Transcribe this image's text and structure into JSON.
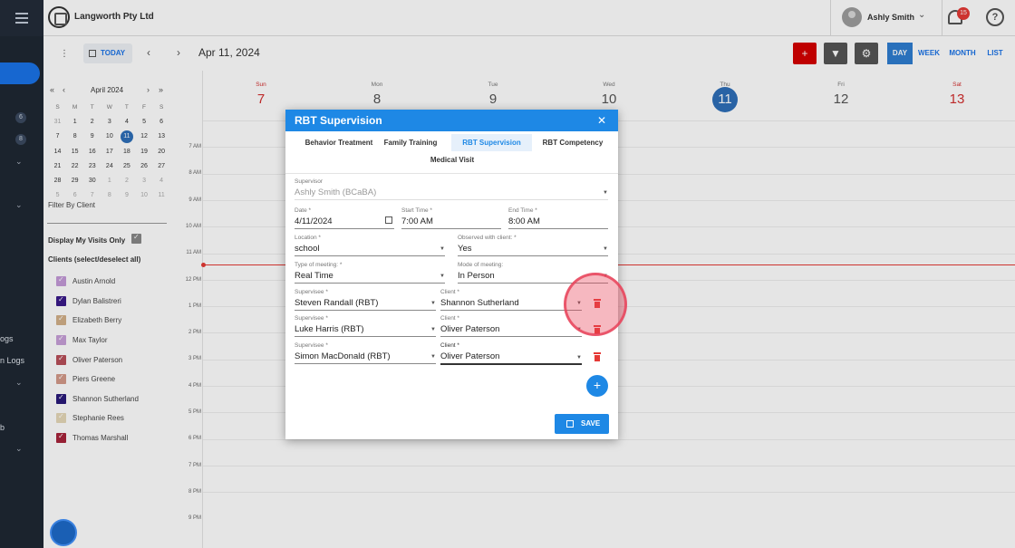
{
  "app": {
    "company": "Langworth Pty Ltd",
    "user_name": "Ashly Smith",
    "notification_count": "15",
    "help_glyph": "?"
  },
  "leftnav": {
    "badges": [
      "6",
      "8"
    ],
    "cut_labels": [
      "ogs",
      "n Logs",
      "b"
    ]
  },
  "toolbar": {
    "today_label": "TODAY",
    "current_date": "Apr 11, 2024",
    "add_glyph": "+",
    "views": [
      "DAY",
      "WEEK",
      "MONTH",
      "LIST"
    ],
    "active_view": "DAY"
  },
  "minical": {
    "title": "April 2024",
    "weekday_headers": [
      "S",
      "M",
      "T",
      "W",
      "T",
      "F",
      "S"
    ],
    "weeks": [
      [
        "31",
        "1",
        "2",
        "3",
        "4",
        "5",
        "6"
      ],
      [
        "7",
        "8",
        "9",
        "10",
        "11",
        "12",
        "13"
      ],
      [
        "14",
        "15",
        "16",
        "17",
        "18",
        "19",
        "20"
      ],
      [
        "21",
        "22",
        "23",
        "24",
        "25",
        "26",
        "27"
      ],
      [
        "28",
        "29",
        "30",
        "1",
        "2",
        "3",
        "4"
      ],
      [
        "5",
        "6",
        "7",
        "8",
        "9",
        "10",
        "11"
      ]
    ],
    "selected_day": "11"
  },
  "filters": {
    "filter_by_client": "Filter By Client",
    "display_my_visits": "Display My Visits Only",
    "clients_header": "Clients (select/deselect all)",
    "clients": [
      {
        "name": "Austin Arnold",
        "color": "#c49ad8"
      },
      {
        "name": "Dylan Balistreri",
        "color": "#3a1a8a"
      },
      {
        "name": "Elizabeth Berry",
        "color": "#d3b08a"
      },
      {
        "name": "Max Taylor",
        "color": "#c8a0d8"
      },
      {
        "name": "Oliver Paterson",
        "color": "#b8505a"
      },
      {
        "name": "Piers Greene",
        "color": "#d49a8a"
      },
      {
        "name": "Shannon Sutherland",
        "color": "#2a1a7a"
      },
      {
        "name": "Stephanie Rees",
        "color": "#e6d8b8"
      },
      {
        "name": "Thomas Marshall",
        "color": "#a8243a"
      }
    ]
  },
  "week": {
    "days": [
      {
        "name": "Sun",
        "date": "7"
      },
      {
        "name": "Mon",
        "date": "8"
      },
      {
        "name": "Tue",
        "date": "9"
      },
      {
        "name": "Wed",
        "date": "10"
      },
      {
        "name": "Thu",
        "date": "11"
      },
      {
        "name": "Fri",
        "date": "12"
      },
      {
        "name": "Sat",
        "date": "13"
      }
    ],
    "hours": [
      "7 AM",
      "8 AM",
      "9 AM",
      "10 AM",
      "11 AM",
      "12 PM",
      "1 PM",
      "2 PM",
      "3 PM",
      "4 PM",
      "5 PM",
      "6 PM",
      "7 PM",
      "8 PM",
      "9 PM"
    ]
  },
  "modal": {
    "title": "RBT Supervision",
    "close_glyph": "✕",
    "tabs": [
      "Behavior Treatment",
      "Family Training",
      "RBT Supervision",
      "RBT Competency",
      "Medical Visit"
    ],
    "active_tab": "RBT Supervision",
    "supervisor_label": "Supervisor",
    "supervisor_value": "Ashly Smith (BCaBA)",
    "date_label": "Date *",
    "date_value": "4/11/2024",
    "start_label": "Start Time *",
    "start_value": "7:00 AM",
    "end_label": "End Time *",
    "end_value": "8:00 AM",
    "location_label": "Location *",
    "location_value": "school",
    "observed_label": "Observed with client: *",
    "observed_value": "Yes",
    "type_label": "Type of meeting: *",
    "type_value": "Real Time",
    "mode_label": "Mode of meeting:",
    "mode_value": "In Person",
    "supervisee_label": "Supervisee *",
    "client_label": "Client *",
    "rows": [
      {
        "supervisee": "Steven Randall (RBT)",
        "client": "Shannon Sutherland"
      },
      {
        "supervisee": "Luke Harris (RBT)",
        "client": "Oliver Paterson"
      },
      {
        "supervisee": "Simon MacDonald (RBT)",
        "client": "Oliver Paterson"
      }
    ],
    "add_glyph": "+",
    "save_label": "SAVE"
  }
}
